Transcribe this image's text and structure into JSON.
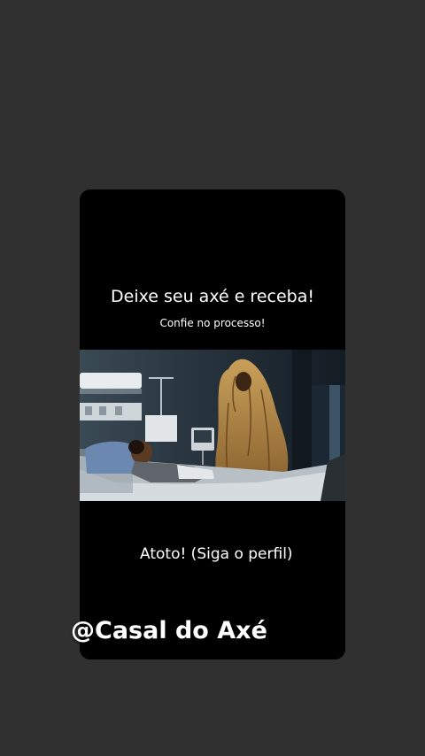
{
  "story": {
    "headline": "Deixe seu axé e receba!",
    "subheadline": "Confie no processo!",
    "caption": "Atoto! (Siga o perfil)",
    "handle": "@Casal do Axé"
  },
  "colors": {
    "background": "#303030",
    "card": "#000000",
    "text": "#ffffff"
  }
}
